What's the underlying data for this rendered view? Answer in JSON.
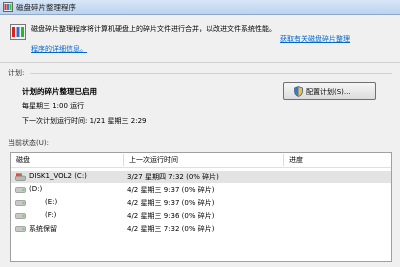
{
  "window": {
    "title": "磁盘碎片整理程序"
  },
  "header": {
    "description": "磁盘碎片整理程序将计算机硬盘上的碎片文件进行合并，以改进文件系统性能。",
    "help_link": "获取有关磁盘碎片整理程序的详细信息。",
    "help_link_line1": "获取有关磁盘碎片整理",
    "help_link_line2": "程序的详细信息。"
  },
  "schedule": {
    "section_label": "计划:",
    "status": "计划的碎片整理已启用",
    "run_time": "每星期三  1:00 运行",
    "next_run": "下一次计划运行时间: 1/21 星期三 2:29",
    "config_button": "配置计划(S)..."
  },
  "current_status": {
    "section_label": "当前状态(U):",
    "columns": {
      "disk": "磁盘",
      "last_run": "上一次运行时间",
      "progress": "进度"
    },
    "volumes": [
      {
        "name": "DISK1_VOL2 (C:)",
        "last_run": "3/27 星期四 7:32 (0% 碎片)",
        "progress": "",
        "icon": "system-drive-icon",
        "selected": true
      },
      {
        "name": "(D:)",
        "last_run": "4/2 星期三 9:37 (0% 碎片)",
        "progress": "",
        "icon": "drive-icon"
      },
      {
        "name": "(E:)",
        "last_run": "4/2 星期三 9:37 (0% 碎片)",
        "progress": "",
        "icon": "drive-icon"
      },
      {
        "name": "(F:)",
        "last_run": "4/2 星期三 9:36 (0% 碎片)",
        "progress": "",
        "icon": "drive-icon"
      },
      {
        "name": "系统保留",
        "last_run": "4/2 星期三 7:32 (0% 碎片)",
        "progress": "",
        "icon": "drive-icon"
      }
    ]
  },
  "colors": {
    "link": "#0066cc",
    "selected_row": "#e3e3e3",
    "titlebar": "#c9ddf3"
  }
}
